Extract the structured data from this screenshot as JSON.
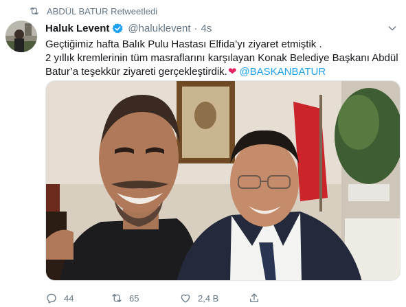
{
  "retweet": {
    "text": "ABDÜL BATUR Retweetledi"
  },
  "tweet": {
    "author_name": "Haluk Levent",
    "handle": "@haluklevent",
    "separator": "·",
    "time": "4s",
    "text_lines": [
      "Geçtiğimiz hafta Balık Pulu Hastası Elfida’yı ziyaret etmiştik .",
      "2 yıllık kremlerinin tüm masraflarını karşılayan Konak Belediye Başkanı Abdül",
      "Batur’a teşekkür ziyareti gerçekleştirdik."
    ],
    "heart_emoji": "❤",
    "mention": "@BASKANBATUR"
  },
  "actions": {
    "reply_count": "44",
    "retweet_count": "65",
    "like_count": "2,4 B"
  },
  "colors": {
    "accent": "#1da1f2",
    "muted": "#657786",
    "heart": "#e0245e"
  }
}
